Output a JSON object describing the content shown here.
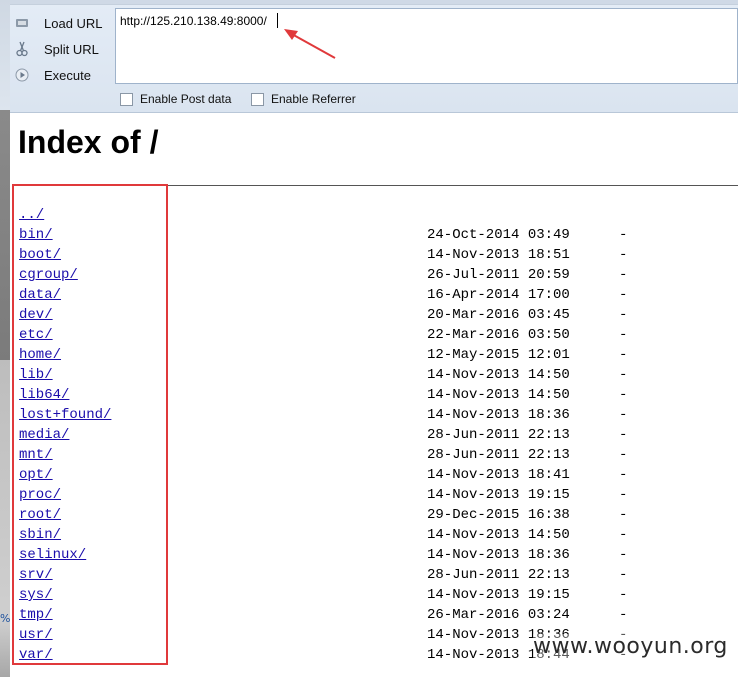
{
  "sidebar": {
    "zoom_fragment": "%"
  },
  "hackbar": {
    "buttons": [
      {
        "label": "Load URL",
        "icon": "load-url-icon"
      },
      {
        "label": "Split URL",
        "icon": "split-url-icon"
      },
      {
        "label": "Execute",
        "icon": "execute-icon"
      }
    ],
    "url_value": "http://125.210.138.49:8000/",
    "checkboxes": [
      {
        "label": "Enable Post data",
        "checked": false
      },
      {
        "label": "Enable Referrer",
        "checked": false
      }
    ]
  },
  "page": {
    "title": "Index of /",
    "parent_link": "../",
    "entries": [
      {
        "name": "bin/",
        "date": "24-Oct-2014 03:49",
        "size": "-"
      },
      {
        "name": "boot/",
        "date": "14-Nov-2013 18:51",
        "size": "-"
      },
      {
        "name": "cgroup/",
        "date": "26-Jul-2011 20:59",
        "size": "-"
      },
      {
        "name": "data/",
        "date": "16-Apr-2014 17:00",
        "size": "-"
      },
      {
        "name": "dev/",
        "date": "20-Mar-2016 03:45",
        "size": "-"
      },
      {
        "name": "etc/",
        "date": "22-Mar-2016 03:50",
        "size": "-"
      },
      {
        "name": "home/",
        "date": "12-May-2015 12:01",
        "size": "-"
      },
      {
        "name": "lib/",
        "date": "14-Nov-2013 14:50",
        "size": "-"
      },
      {
        "name": "lib64/",
        "date": "14-Nov-2013 14:50",
        "size": "-"
      },
      {
        "name": "lost+found/",
        "date": "14-Nov-2013 18:36",
        "size": "-"
      },
      {
        "name": "media/",
        "date": "28-Jun-2011 22:13",
        "size": "-"
      },
      {
        "name": "mnt/",
        "date": "28-Jun-2011 22:13",
        "size": "-"
      },
      {
        "name": "opt/",
        "date": "14-Nov-2013 18:41",
        "size": "-"
      },
      {
        "name": "proc/",
        "date": "14-Nov-2013 19:15",
        "size": "-"
      },
      {
        "name": "root/",
        "date": "29-Dec-2015 16:38",
        "size": "-"
      },
      {
        "name": "sbin/",
        "date": "14-Nov-2013 14:50",
        "size": "-"
      },
      {
        "name": "selinux/",
        "date": "14-Nov-2013 18:36",
        "size": "-"
      },
      {
        "name": "srv/",
        "date": "28-Jun-2011 22:13",
        "size": "-"
      },
      {
        "name": "sys/",
        "date": "14-Nov-2013 19:15",
        "size": "-"
      },
      {
        "name": "tmp/",
        "date": "26-Mar-2016 03:24",
        "size": "-"
      },
      {
        "name": "usr/",
        "date": "14-Nov-2013 18:36",
        "size": "-"
      },
      {
        "name": "var/",
        "date": "14-Nov-2013 18:44",
        "size": "-"
      }
    ]
  },
  "watermark": "www.wooyun.org",
  "colors": {
    "annotation": "#e0393b",
    "link": "#1a0dab",
    "hackbar_bg": "#dae4f0"
  }
}
